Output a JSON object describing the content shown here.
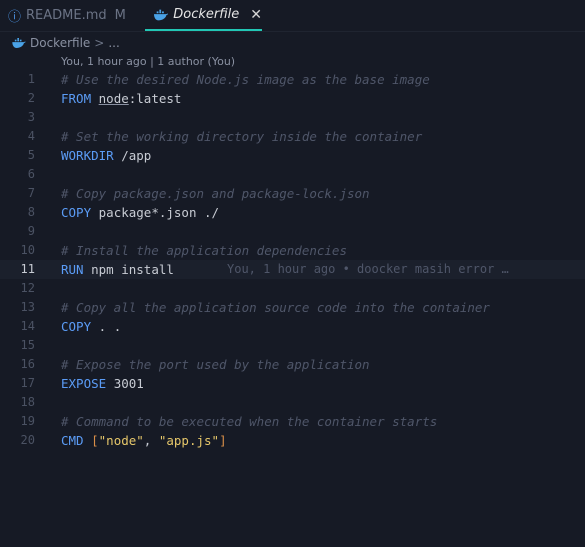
{
  "tabs": [
    {
      "label": "README.md",
      "status": "M",
      "icon": "markdown-icon"
    },
    {
      "label": "Dockerfile",
      "icon": "docker-whale-icon",
      "close": "✕"
    }
  ],
  "breadcrumb": {
    "file": "Dockerfile",
    "separator": ">",
    "more": "..."
  },
  "blame_header": "You, 1 hour ago | 1 author (You)",
  "active_line": 11,
  "lines": [
    {
      "n": "1",
      "comment": "# Use the desired Node.js image as the base image"
    },
    {
      "n": "2",
      "kw": "FROM",
      "a": "node",
      "b": ":latest"
    },
    {
      "n": "3"
    },
    {
      "n": "4",
      "comment": "# Set the working directory inside the container"
    },
    {
      "n": "5",
      "kw": "WORKDIR",
      "a": "/app"
    },
    {
      "n": "6"
    },
    {
      "n": "7",
      "comment": "# Copy package.json and package-lock.json"
    },
    {
      "n": "8",
      "kw": "COPY",
      "a": "package*.json ./"
    },
    {
      "n": "9"
    },
    {
      "n": "10",
      "comment": "# Install the application dependencies"
    },
    {
      "n": "11",
      "kw": "RUN",
      "a": "npm install",
      "blame": "You, 1 hour ago • doocker masih error …"
    },
    {
      "n": "12"
    },
    {
      "n": "13",
      "comment": "# Copy all the application source code into the container"
    },
    {
      "n": "14",
      "kw": "COPY",
      "a": ". ."
    },
    {
      "n": "15"
    },
    {
      "n": "16",
      "comment": "# Expose the port used by the application"
    },
    {
      "n": "17",
      "kw": "EXPOSE",
      "a": "3001"
    },
    {
      "n": "18"
    },
    {
      "n": "19",
      "comment": "# Command to be executed when the container starts"
    },
    {
      "n": "20",
      "kw": "CMD",
      "open": "[",
      "s1": "\"node\"",
      "comma": ", ",
      "s2": "\"app.js\"",
      "close": "]"
    }
  ]
}
